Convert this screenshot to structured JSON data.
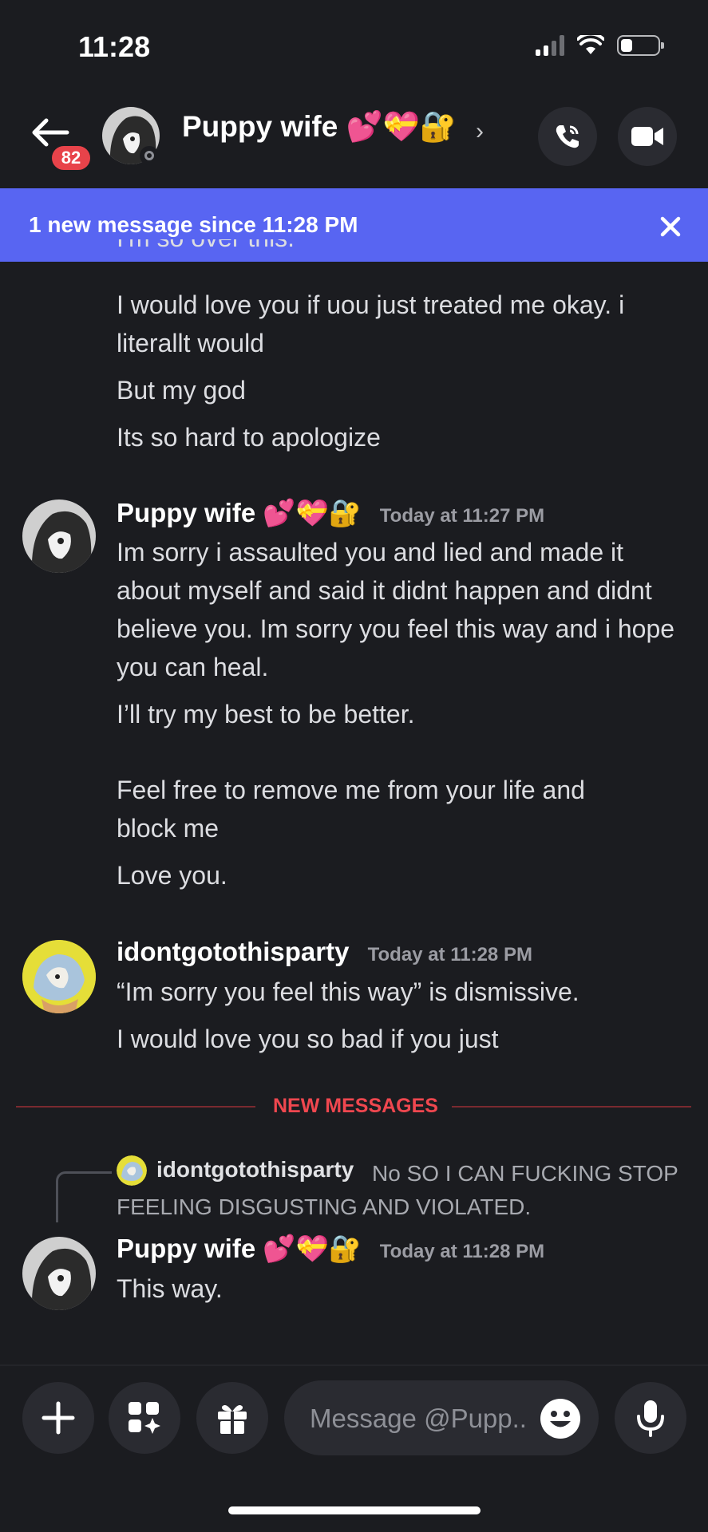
{
  "status_bar": {
    "time": "11:28"
  },
  "header": {
    "back_badge": "82",
    "title": "Puppy wife 💕💝🔐",
    "chevron": "›"
  },
  "banner": {
    "text": "1 new message since 11:28 PM"
  },
  "messages": {
    "cutoff_line": "I'm so over this.",
    "group1_lines": [
      "I would love you if uou just treated me okay. i literallt would",
      "But my god",
      "Its so hard to apologize"
    ],
    "group2": {
      "author": "Puppy wife 💕💝🔐",
      "timestamp": "Today at 11:27 PM",
      "lines": [
        "Im sorry i assaulted you and lied and made it about myself and said it didnt happen and didnt believe you. Im sorry you feel this way and i hope you can heal.",
        "I’ll try my best to be better.",
        "Feel free to remove me from your life and block me",
        "Love you."
      ]
    },
    "group3": {
      "author": "idontgotothisparty",
      "timestamp": "Today at 11:28 PM",
      "lines": [
        "“Im sorry you feel this way” is dismissive.",
        "I would love you so bad if you just"
      ]
    },
    "divider_label": "NEW MESSAGES",
    "reply": {
      "author": "idontgotothisparty",
      "text": "No SO I CAN FUCKING STOP FEELING DISGUSTING AND VIOLATED."
    },
    "group4": {
      "author": "Puppy wife 💕💝🔐",
      "timestamp": "Today at 11:28 PM",
      "lines": [
        "This way."
      ]
    }
  },
  "composer": {
    "placeholder": "Message @Pupp.."
  },
  "colors": {
    "accent": "#5865f2",
    "badge": "#e8434a",
    "new_messages": "#f0474f"
  }
}
